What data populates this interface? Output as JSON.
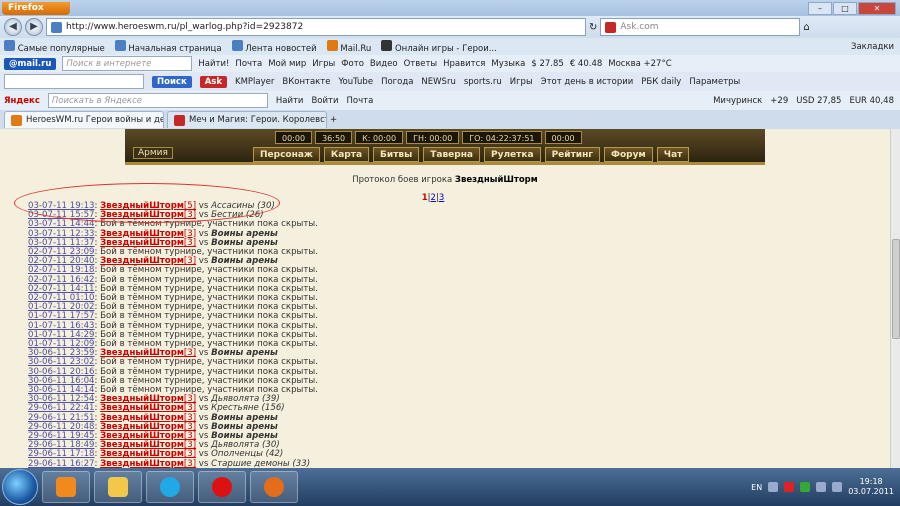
{
  "browser": {
    "app_button": "Firefox",
    "url": "http://www.heroeswm.ru/pl_warlog.php?id=2923872",
    "search_placeholder": "Ask.com"
  },
  "bookmarks": [
    "Самые популярные",
    "Начальная страница",
    "Лента новостей",
    "Mail.Ru",
    "Онлайн игры - Герои...",
    "Закладки"
  ],
  "mail_toolbar": {
    "logo": "@mail.ru",
    "search_placeholder": "Поиск в интернете",
    "find_label": "Найти!",
    "items": [
      "Почта",
      "Мой мир",
      "Игры",
      "Фото",
      "Видео",
      "Ответы",
      "Нравится",
      "Музыка",
      "$ 27.85",
      "€ 40.48",
      "Москва +27°C"
    ]
  },
  "toolbar2": {
    "search_button": "Поиск",
    "ask": "Ask",
    "items": [
      "KMPlayer",
      "ВКонтакте",
      "YouTube",
      "Погода",
      "NEWSru",
      "sports.ru",
      "Игры",
      "Этот день в истории",
      "РБК daily",
      "Параметры"
    ]
  },
  "yandex_bar": {
    "logo": "Яндекс",
    "search_placeholder": "Поискать в Яндексе",
    "find_label": "Найти",
    "enter_label": "Войти",
    "mail_label": "Почта",
    "city": "Мичуринск",
    "temp": "+29",
    "usd": "USD 27,85",
    "eur": "EUR 40,48"
  },
  "tabs": [
    {
      "title": "HeroesWM.ru Герои войны и денег...",
      "active": true
    },
    {
      "title": "Меч и Магия: Герои. Королевства...",
      "active": false
    }
  ],
  "game": {
    "timers": [
      "00:00",
      "36:50",
      "К: 00:00",
      "ГН: 00:00",
      "ГО: 04:22:37:51",
      "00:00"
    ],
    "army_label": "Армия",
    "menu": [
      "Персонаж",
      "Карта",
      "Битвы",
      "Таверна",
      "Рулетка",
      "Рейтинг",
      "Форум",
      "Чат"
    ]
  },
  "protocol": {
    "prefix": "Протокол боев игрока",
    "player": "ЗвездныйШторм",
    "pages": [
      "1",
      "2",
      "3"
    ]
  },
  "battles": [
    {
      "date": "03-07-11 19:13",
      "player": "ЗвездныйШторм",
      "level": "[5]",
      "vs": "vs",
      "opponent": "Ассасины (30)",
      "hidden": ""
    },
    {
      "date": "03-07-11 15:57",
      "player": "ЗвездныйШторм",
      "level": "[3]",
      "vs": "vs",
      "opponent": "Бестии (26)",
      "hidden": ""
    },
    {
      "date": "03-07-11 14:44",
      "player": "",
      "level": "",
      "vs": "",
      "opponent": "",
      "hidden": "Бой в тёмном турнире, участники пока скрыты."
    },
    {
      "date": "03-07-11 12:33",
      "player": "ЗвездныйШторм",
      "level": "[3]",
      "vs": "vs",
      "opponent": "Воины арены",
      "bold": true,
      "hidden": ""
    },
    {
      "date": "03-07-11 11:37",
      "player": "ЗвездныйШторм",
      "level": "[3]",
      "vs": "vs",
      "opponent": "Воины арены",
      "bold": true,
      "hidden": ""
    },
    {
      "date": "02-07-11 23:09",
      "player": "",
      "level": "",
      "vs": "",
      "opponent": "",
      "hidden": "Бой в тёмном турнире, участники пока скрыты."
    },
    {
      "date": "02-07-11 20:40",
      "player": "ЗвездныйШторм",
      "level": "[3]",
      "vs": "vs",
      "opponent": "Воины арены",
      "bold": true,
      "hidden": ""
    },
    {
      "date": "02-07-11 19:18",
      "player": "",
      "level": "",
      "vs": "",
      "opponent": "",
      "hidden": "Бой в тёмном турнире, участники пока скрыты."
    },
    {
      "date": "02-07-11 16:42",
      "player": "",
      "level": "",
      "vs": "",
      "opponent": "",
      "hidden": "Бой в тёмном турнире, участники пока скрыты."
    },
    {
      "date": "02-07-11 14:11",
      "player": "",
      "level": "",
      "vs": "",
      "opponent": "",
      "hidden": "Бой в тёмном турнире, участники пока скрыты."
    },
    {
      "date": "02-07-11 01:10",
      "player": "",
      "level": "",
      "vs": "",
      "opponent": "",
      "hidden": "Бой в тёмном турнире, участники пока скрыты."
    },
    {
      "date": "01-07-11 20:02",
      "player": "",
      "level": "",
      "vs": "",
      "opponent": "",
      "hidden": "Бой в тёмном турнире, участники пока скрыты."
    },
    {
      "date": "01-07-11 17:57",
      "player": "",
      "level": "",
      "vs": "",
      "opponent": "",
      "hidden": "Бой в тёмном турнире, участники пока скрыты."
    },
    {
      "date": "01-07-11 16:43",
      "player": "",
      "level": "",
      "vs": "",
      "opponent": "",
      "hidden": "Бой в тёмном турнире, участники пока скрыты."
    },
    {
      "date": "01-07-11 14:29",
      "player": "",
      "level": "",
      "vs": "",
      "opponent": "",
      "hidden": "Бой в тёмном турнире, участники пока скрыты."
    },
    {
      "date": "01-07-11 12:09",
      "player": "",
      "level": "",
      "vs": "",
      "opponent": "",
      "hidden": "Бой в тёмном турнире, участники пока скрыты."
    },
    {
      "date": "30-06-11 23:59",
      "player": "ЗвездныйШторм",
      "level": "[3]",
      "vs": "vs",
      "opponent": "Воины арены",
      "bold": true,
      "hidden": ""
    },
    {
      "date": "30-06-11 23:02",
      "player": "",
      "level": "",
      "vs": "",
      "opponent": "",
      "hidden": "Бой в тёмном турнире, участники пока скрыты."
    },
    {
      "date": "30-06-11 20:16",
      "player": "",
      "level": "",
      "vs": "",
      "opponent": "",
      "hidden": "Бой в тёмном турнире, участники пока скрыты."
    },
    {
      "date": "30-06-11 16:04",
      "player": "",
      "level": "",
      "vs": "",
      "opponent": "",
      "hidden": "Бой в тёмном турнире, участники пока скрыты."
    },
    {
      "date": "30-06-11 14:14",
      "player": "",
      "level": "",
      "vs": "",
      "opponent": "",
      "hidden": "Бой в тёмном турнире, участники пока скрыты."
    },
    {
      "date": "30-06-11 12:54",
      "player": "ЗвездныйШторм",
      "level": "[3]",
      "vs": "vs",
      "opponent": "Дьяволята (39)",
      "hidden": ""
    },
    {
      "date": "29-06-11 22:41",
      "player": "ЗвездныйШторм",
      "level": "[3]",
      "vs": "vs",
      "opponent": "Крестьяне (156)",
      "hidden": ""
    },
    {
      "date": "29-06-11 21:51",
      "player": "ЗвездныйШторм",
      "level": "[3]",
      "vs": "vs",
      "opponent": "Воины арены",
      "bold": true,
      "hidden": ""
    },
    {
      "date": "29-06-11 20:48",
      "player": "ЗвездныйШторм",
      "level": "[3]",
      "vs": "vs",
      "opponent": "Воины арены",
      "bold": true,
      "hidden": ""
    },
    {
      "date": "29-06-11 19:45",
      "player": "ЗвездныйШторм",
      "level": "[3]",
      "vs": "vs",
      "opponent": "Воины арены",
      "bold": true,
      "hidden": ""
    },
    {
      "date": "29-06-11 18:49",
      "player": "ЗвездныйШторм",
      "level": "[3]",
      "vs": "vs",
      "opponent": "Дьяволята (30)",
      "hidden": ""
    },
    {
      "date": "29-06-11 17:18",
      "player": "ЗвездныйШторм",
      "level": "[3]",
      "vs": "vs",
      "opponent": "Ополченцы (42)",
      "hidden": ""
    },
    {
      "date": "29-06-11 16:27",
      "player": "ЗвездныйШторм",
      "level": "[3]",
      "vs": "vs",
      "opponent": "Старшие демоны (33)",
      "hidden": ""
    }
  ],
  "taskbar": {
    "lang": "EN",
    "time": "19:18",
    "date": "03.07.2011"
  }
}
